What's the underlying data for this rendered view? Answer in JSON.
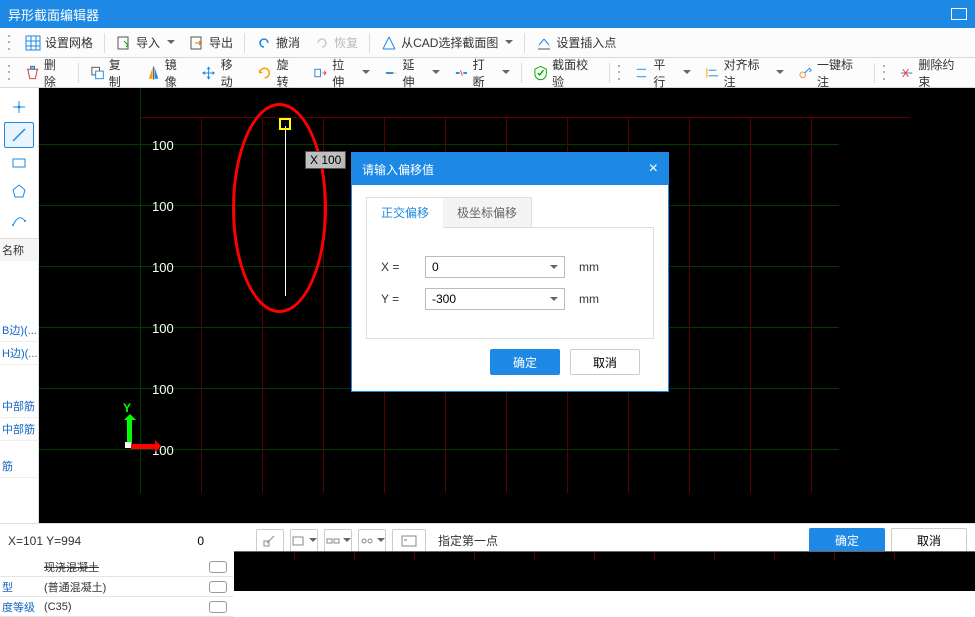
{
  "window": {
    "title": "异形截面编辑器"
  },
  "toolbar1": {
    "grid": "设置网格",
    "import": "导入",
    "export": "导出",
    "undo": "撤消",
    "redo": "恢复",
    "cad": "从CAD选择截面图",
    "insert": "设置插入点"
  },
  "toolbar2": {
    "delete": "删除",
    "copy": "复制",
    "mirror": "镜像",
    "move": "移动",
    "rotate": "旋转",
    "stretch": "拉伸",
    "extend": "延伸",
    "break": "打断",
    "verify": "截面校验",
    "parallel": "平行",
    "align": "对齐标注",
    "onekey": "一键标注",
    "delcons": "删除约束"
  },
  "side_tools": [
    "point",
    "line",
    "rect",
    "pentagon",
    "curve",
    "text"
  ],
  "properties": {
    "tab": "名称",
    "items": [
      "B边)(...",
      "H边)(...",
      "中部筋",
      "中部筋",
      "筋"
    ]
  },
  "canvas": {
    "ruler_labels": [
      "100",
      "100",
      "100",
      "100",
      "100",
      "100"
    ],
    "pointer_label": "X 100",
    "axis_y": "Y",
    "axis_x": "X"
  },
  "dialog": {
    "title": "请输入偏移值",
    "tabs": {
      "ortho": "正交偏移",
      "polar": "极坐标偏移"
    },
    "x_label": "X =",
    "y_label": "Y =",
    "x_value": "0",
    "y_value": "-300",
    "unit": "mm",
    "ok": "确定",
    "cancel": "取消"
  },
  "status": {
    "coord": "X=101 Y=994",
    "zero": "0",
    "prompt": "指定第一点",
    "ok": "确定",
    "cancel": "取消"
  },
  "bottom_rows": [
    {
      "label": "",
      "value": "现浇混凝土"
    },
    {
      "label": "型",
      "value": "(普通混凝土)"
    },
    {
      "label": "度等级",
      "value": "(C35)"
    }
  ]
}
